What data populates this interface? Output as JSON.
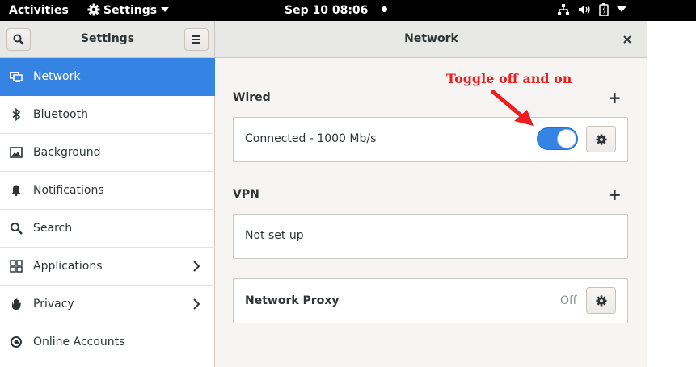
{
  "topbar": {
    "activities": "Activities",
    "app_menu": "Settings",
    "clock": "Sep 10  08:06",
    "tray_icons": [
      "network-icon",
      "volume-icon",
      "battery-icon",
      "system-menu-caret"
    ]
  },
  "header": {
    "sidebar_title": "Settings",
    "main_title": "Network"
  },
  "sidebar": {
    "items": [
      {
        "label": "Network",
        "icon": "network-icon",
        "active": true
      },
      {
        "label": "Bluetooth",
        "icon": "bluetooth-icon"
      },
      {
        "label": "Background",
        "icon": "background-icon"
      },
      {
        "label": "Notifications",
        "icon": "bell-icon"
      },
      {
        "label": "Search",
        "icon": "search-icon"
      },
      {
        "label": "Applications",
        "icon": "apps-grid-icon",
        "has_submenu": true
      },
      {
        "label": "Privacy",
        "icon": "hand-icon",
        "has_submenu": true
      },
      {
        "label": "Online Accounts",
        "icon": "online-accounts-icon"
      }
    ]
  },
  "network": {
    "wired": {
      "title": "Wired",
      "status": "Connected - 1000 Mb/s",
      "switch_on": true
    },
    "vpn": {
      "title": "VPN",
      "status": "Not set up"
    },
    "proxy": {
      "label": "Network Proxy",
      "value": "Off"
    }
  },
  "annotation": {
    "text": "Toggle off and on",
    "color": "#ee1c1c"
  },
  "colors": {
    "accent": "#3584e4",
    "annotation": "#ee1c1c"
  }
}
